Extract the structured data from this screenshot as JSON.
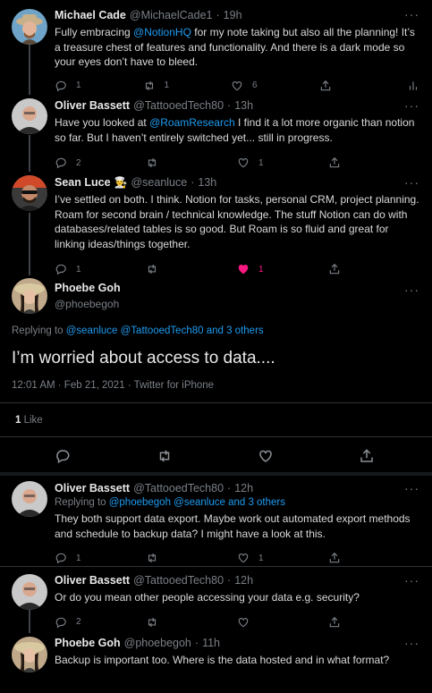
{
  "tweets": [
    {
      "name": "Michael Cade",
      "handle": "@MichaelCade1",
      "time": "19h",
      "body_pre": "Fully embracing ",
      "body_link": "@NotionHQ",
      "body_post": " for my note taking but also all the planning! It’s a treasure chest of features and functionality. And there is a dark mode so your eyes don’t have to bleed.",
      "reply_count": "1",
      "retweet_count": "1",
      "like_count": "6"
    },
    {
      "name": "Oliver Bassett",
      "handle": "@TattooedTech80",
      "time": "13h",
      "body_pre": "Have you looked at ",
      "body_link": "@RoamResearch",
      "body_post": "  I find it a lot more organic than notion so far. But I haven’t entirely switched yet... still in progress.",
      "reply_count": "2",
      "retweet_count": "",
      "like_count": "1"
    },
    {
      "name": "Sean Luce",
      "name_emoji": "👨‍🍳",
      "handle": "@seanluce",
      "time": "13h",
      "body": "I’ve settled on both. I think. Notion for tasks, personal CRM, project planning. Roam for second brain / technical knowledge. The stuff Notion can do with databases/related tables is so good. But Roam is so fluid and great for linking ideas/things together.",
      "reply_count": "1",
      "retweet_count": "",
      "like_count": "1"
    }
  ],
  "focus": {
    "name": "Phoebe Goh",
    "handle": "@phoebegoh",
    "replying_label": "Replying to ",
    "replying_links": "@seanluce @TattooedTech80 and 3 others",
    "text": "I’m worried about access to data....",
    "meta": "12:01 AM · Feb 21, 2021 · Twitter for iPhone",
    "like_count": "1",
    "like_label": "Like"
  },
  "replies": [
    {
      "name": "Oliver Bassett",
      "handle": "@TattooedTech80",
      "time": "12h",
      "replying_label": "Replying to ",
      "replying_links": "@phoebegoh @seanluce and 3 others",
      "body": "They both support data export. Maybe work out automated export methods and schedule to backup data? I might have a look at this.",
      "reply_count": "1",
      "retweet_count": "",
      "like_count": "1"
    },
    {
      "name": "Oliver Bassett",
      "handle": "@TattooedTech80",
      "time": "12h",
      "body": "Or do you mean other people accessing your data e.g. security?",
      "reply_count": "2",
      "retweet_count": "",
      "like_count": ""
    },
    {
      "name": "Phoebe Goh",
      "handle": "@phoebegoh",
      "time": "11h",
      "body": "Backup is important too. Where is the data hosted and in what format?"
    }
  ],
  "common": {
    "dot": "·",
    "more": "···"
  },
  "colors": {
    "background": "#000000",
    "link": "#1d9bf0",
    "muted": "#7a7f85",
    "like_active": "#f91880",
    "separator": "#2f3336"
  },
  "icons": [
    "reply-icon",
    "retweet-icon",
    "like-icon",
    "share-icon",
    "analytics-icon",
    "more-icon"
  ]
}
